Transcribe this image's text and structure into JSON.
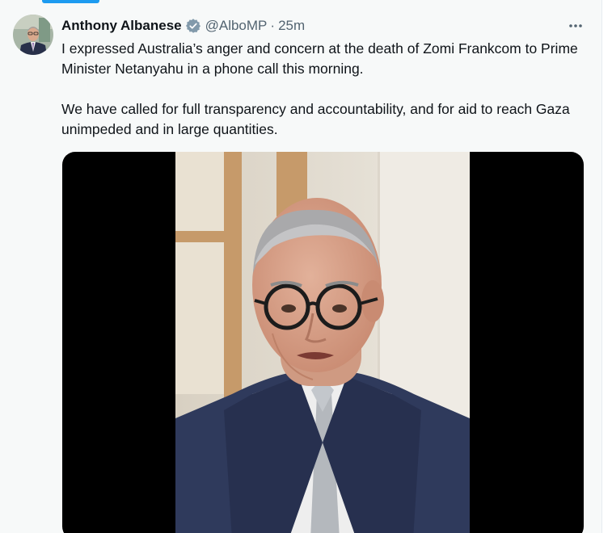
{
  "tweet": {
    "author": {
      "display_name": "Anthony Albanese",
      "verified_badge_icon": "verified-badge-icon",
      "handle": "@AlboMP",
      "separator": "·",
      "time": "25m"
    },
    "more_icon": "more-options-icon",
    "text": {
      "paragraph_1": "I expressed Australia’s anger and concern at the death of Zomi Frankcom to Prime Minister Netanyahu in a phone call this morning.",
      "paragraph_2": "We have called for full transparency and accountability, and for aid to reach Gaza unimpeded and in large quantities."
    },
    "media": {
      "type": "video",
      "subject": "man in glasses, dark suit, white shirt, grey tie speaking"
    }
  },
  "colors": {
    "accent": "#1d9bf0",
    "text_primary": "#0f1419",
    "text_secondary": "#536471",
    "background": "#f7f9f9"
  }
}
